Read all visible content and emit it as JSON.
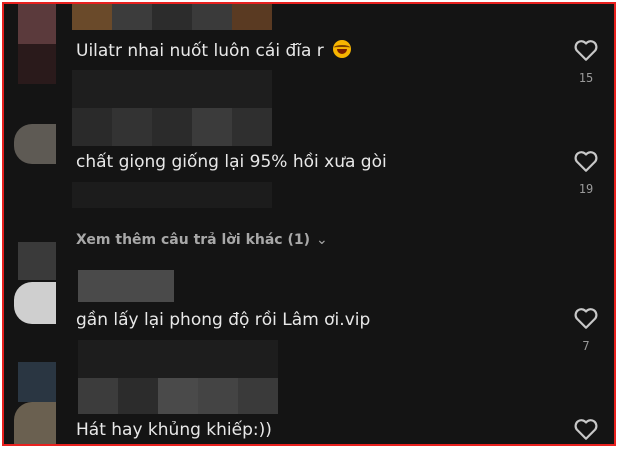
{
  "comments": [
    {
      "text": "Uilatr nhai nuốt luôn cái đĩa r",
      "emoji": "laughing-tears-emoji",
      "likes": "15"
    },
    {
      "text": "chất giọng giống lại 95% hồi xưa gòi",
      "likes": "19"
    },
    {
      "text": "gần lấy lại phong độ rồi Lâm ơi.vip",
      "likes": "7"
    },
    {
      "text": "Hát hay khủng khiếp:))",
      "likes": ""
    }
  ],
  "more_replies": {
    "label": "Xem thêm câu trả lời khác (1)",
    "icon": "chevron-down-icon"
  },
  "colors": {
    "background": "#141414",
    "border": "#e8211f",
    "text": "#e8e8e8",
    "muted": "#9a9a9a"
  }
}
